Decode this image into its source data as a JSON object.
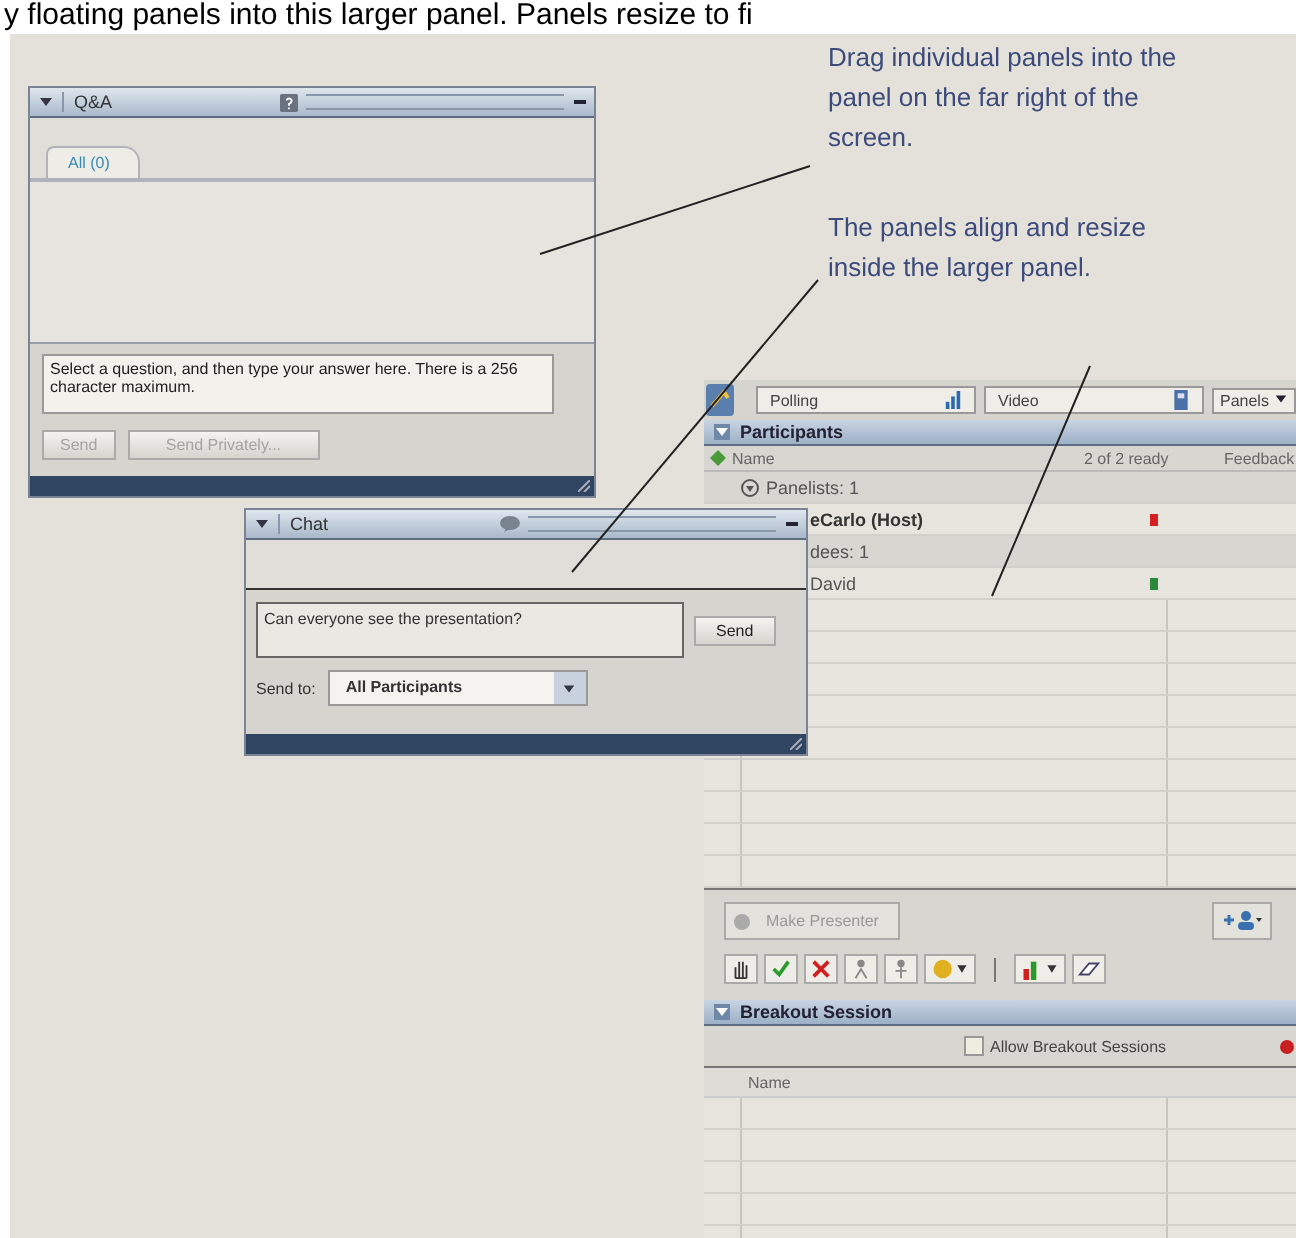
{
  "caption": "y floating panels into this larger panel. Panels resize to fi",
  "callouts": [
    "Drag individual panels into the panel on the far right of the screen.",
    "The panels align and resize inside the larger panel."
  ],
  "qa_panel": {
    "title": "Q&A",
    "tabs": [
      {
        "label": "All (0)",
        "selected": true
      }
    ],
    "answer_box": {
      "placeholder": "Select a question, and then type your answer here. There is a 256 character maximum."
    },
    "buttons": [
      {
        "label": "Send",
        "disabled": true
      },
      {
        "label": "Send Privately...",
        "disabled": true
      }
    ]
  },
  "chat_panel": {
    "title": "Chat",
    "message_box": {
      "value": "Can everyone see the presentation?"
    },
    "send_button": "Send",
    "send_to_label": "Send to:",
    "send_to": "All Participants"
  },
  "docked_panel": {
    "tabs": [
      {
        "label": "Polling",
        "selected": false
      },
      {
        "label": "Video",
        "selected": false
      }
    ],
    "panels_menu": "Panels",
    "participants": {
      "title": "Participants",
      "columns": [
        "Name",
        "2 of 2 ready",
        "Feedback"
      ],
      "groups": [
        {
          "label": "Panelists: 1",
          "expanded": true,
          "children": [
            {
              "name": "eCarlo (Host)",
              "host": true,
              "color": "#d42020"
            }
          ]
        },
        {
          "label": "dees: 1",
          "children": [
            {
              "name": "David",
              "host": false,
              "color": "#2a8a3a"
            }
          ]
        }
      ]
    },
    "make_presenter": {
      "label": "Make Presenter",
      "disabled": true
    },
    "breakout": {
      "title": "Breakout Session",
      "allow": {
        "label": "Allow Breakout Sessions",
        "checked": false
      },
      "columns": [
        "Name"
      ]
    }
  }
}
